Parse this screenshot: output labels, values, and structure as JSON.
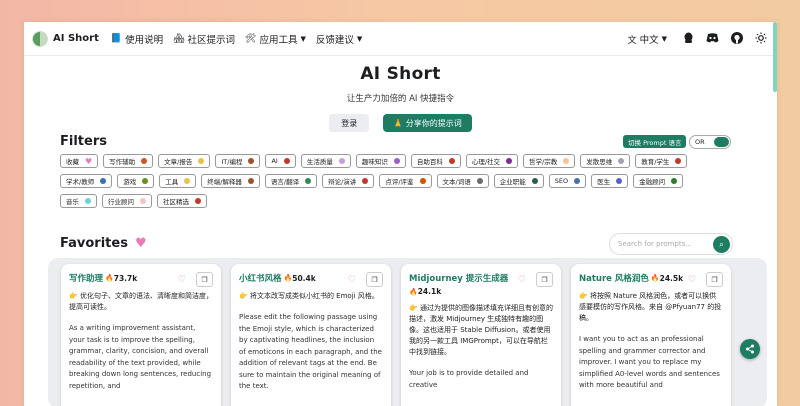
{
  "nav": {
    "brand": "AI Short",
    "items": [
      {
        "icon": "📘",
        "label": "使用说明"
      },
      {
        "icon": "🏘",
        "label": "社区提示词"
      },
      {
        "icon": "🛠",
        "label": "应用工具"
      },
      {
        "icon": "",
        "label": "反馈建议"
      }
    ],
    "language": "中文"
  },
  "hero": {
    "title": "AI Short",
    "subtitle": "让生产力加倍的 AI 快捷指令",
    "login": "登录",
    "share": "🙏 分享你的提示词"
  },
  "filters": {
    "heading": "Filters",
    "switch_lang": "切换 Prompt 语言",
    "logic": "OR",
    "rows": [
      [
        {
          "label": "收藏",
          "color": "#ea7ab8",
          "heart": true
        },
        {
          "label": "写作辅助",
          "color": "#c75a2a"
        },
        {
          "label": "文章/报告",
          "color": "#e6c34f"
        },
        {
          "label": "IT/编程",
          "color": "#a0522d"
        },
        {
          "label": "AI",
          "color": "#c0392b"
        },
        {
          "label": "生活质量",
          "color": "#c79fd6"
        },
        {
          "label": "趣味知识",
          "color": "#9b5fc0"
        },
        {
          "label": "自助百科",
          "color": "#c0392b"
        },
        {
          "label": "心理/社交",
          "color": "#7f2b8f"
        },
        {
          "label": "哲学/宗教",
          "color": "#f0c69c"
        },
        {
          "label": "发散思维",
          "color": "#9fa5b0"
        },
        {
          "label": "教育/学生",
          "color": "#c0392b"
        }
      ],
      [
        {
          "label": "学术/教师",
          "color": "#3b6fb6"
        },
        {
          "label": "游戏",
          "color": "#6b8e23"
        },
        {
          "label": "工具",
          "color": "#e6c34f"
        },
        {
          "label": "终端/解释器",
          "color": "#a0522d"
        },
        {
          "label": "语言/翻译",
          "color": "#2e8b57"
        },
        {
          "label": "辩论/演讲",
          "color": "#c0392b"
        },
        {
          "label": "点评/评鉴",
          "color": "#d35400"
        },
        {
          "label": "文本/词语",
          "color": "#6b6b6b"
        },
        {
          "label": "企业职能",
          "color": "#2c5e4f"
        },
        {
          "label": "SEO",
          "color": "#4d6fa8"
        },
        {
          "label": "医生",
          "color": "#5b5fc7"
        },
        {
          "label": "金融顾问",
          "color": "#2e7d32"
        }
      ],
      [
        {
          "label": "音乐",
          "color": "#6fd3d6"
        },
        {
          "label": "行业顾问",
          "color": "#f2c6c6"
        },
        {
          "label": "社区精选",
          "color": "#c0392b"
        }
      ]
    ]
  },
  "favorites": {
    "heading": "Favorites",
    "search_placeholder": "Search for prompts..."
  },
  "cards": [
    {
      "title": "写作助理",
      "count": "73.7k",
      "desc": "👉 优化句子、文章的语法、清晰度和简洁度，提高可读性。",
      "body": "As a writing improvement assistant, your task is to improve the spelling, grammar, clarity, concision, and overall readability of the text provided, while breaking down long sentences, reducing repetition, and"
    },
    {
      "title": "小红书风格",
      "count": "50.4k",
      "desc": "👉 将文本改写成类似小红书的 Emoji 风格。",
      "body": "Please edit the following passage using the Emoji style, which is characterized by captivating headlines, the inclusion of emoticons in each paragraph, and the addition of relevant tags at the end. Be sure to maintain the original meaning of the text."
    },
    {
      "title": "Midjourney 提示生成器",
      "count": "24.1k",
      "desc": "👉 通过为提供的图像描述填充详细且有创意的描述，激发 Midjourney 生成独特有趣的图像。这也适用于 Stable Diffusion。或者使用我的另一款工具 IMGPrompt，可以在导航栏中找到链接。",
      "body": "Your job is to provide detailed and creative"
    },
    {
      "title": "Nature 风格润色",
      "count": "24.5k",
      "desc": "👉 将按照 Nature 风格润色，或者可以换供感要模仿的写作风格。来自 @Pfyuan77 的投稿。",
      "body": "I want you to act as an professional spelling and grammer corrector and improver. I want you to replace my simplified A0-level words and sentences with more beautiful and"
    }
  ]
}
